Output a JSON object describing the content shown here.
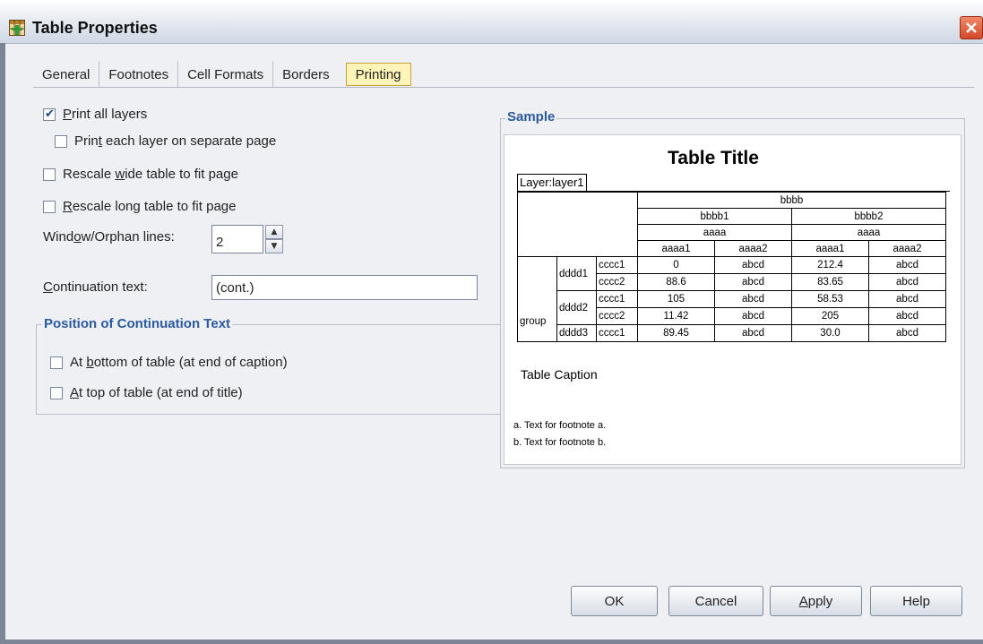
{
  "window": {
    "title": "Table Properties"
  },
  "tabs": [
    {
      "label": "General",
      "active": false
    },
    {
      "label": "Footnotes",
      "active": false
    },
    {
      "label": "Cell Formats",
      "active": false
    },
    {
      "label": "Borders",
      "active": false
    },
    {
      "label": "Printing",
      "active": true
    }
  ],
  "options": {
    "print_all_layers": {
      "pre": "",
      "key": "P",
      "post": "rint all layers",
      "checked": true
    },
    "print_each_layer": {
      "pre": "Prin",
      "key": "t",
      "post": " each layer on separate page",
      "checked": false
    },
    "rescale_wide": {
      "pre": "Rescale ",
      "key": "w",
      "post": "ide table to fit page",
      "checked": false
    },
    "rescale_long": {
      "pre": "",
      "key": "R",
      "post": "escale long table to fit page",
      "checked": false
    }
  },
  "widow_orphan": {
    "pre": "Wind",
    "key": "o",
    "post": "w/Orphan lines:",
    "value": "2"
  },
  "continuation": {
    "pre": "",
    "key": "C",
    "post": "ontinuation text:",
    "value": "(cont.)"
  },
  "position_group": {
    "title": "Position of Continuation Text",
    "bottom": {
      "pre": "At ",
      "key": "b",
      "post": "ottom of table (at end of caption)",
      "checked": false
    },
    "top": {
      "pre": "",
      "key": "A",
      "post": "t top of table (at end of title)",
      "checked": false
    }
  },
  "sample": {
    "group_title": "Sample",
    "table_title": "Table Title",
    "layer_label": "Layer:layer1",
    "col_top": "bbbb",
    "col_mid": [
      "bbbb1",
      "bbbb2"
    ],
    "col_sub": [
      "aaaa",
      "aaaa"
    ],
    "col_leaf": [
      "aaaa1",
      "aaaa2",
      "aaaa1",
      "aaaa2"
    ],
    "group_label": "group",
    "row_groups": [
      "dddd1",
      "dddd2",
      "dddd3"
    ],
    "rows": [
      {
        "c": "cccc1",
        "v": [
          "0",
          "abcd",
          "212.4",
          "abcd"
        ]
      },
      {
        "c": "cccc2",
        "v": [
          "88.6",
          "abcd",
          "83.65",
          "abcd"
        ]
      },
      {
        "c": "cccc1",
        "v": [
          "105",
          "abcd",
          "58.53",
          "abcd"
        ]
      },
      {
        "c": "cccc2",
        "v": [
          "11.42",
          "abcd",
          "205",
          "abcd"
        ]
      },
      {
        "c": "cccc1",
        "v": [
          "89.45",
          "abcd",
          "30.0",
          "abcd"
        ]
      }
    ],
    "caption": "Table Caption",
    "footnotes": [
      "a. Text for footnote a.",
      "b. Text for footnote b."
    ]
  },
  "buttons": {
    "ok": {
      "pre": "OK",
      "key": "",
      "post": ""
    },
    "cancel": {
      "pre": "Cancel",
      "key": "",
      "post": ""
    },
    "apply": {
      "pre": "",
      "key": "A",
      "post": "pply"
    },
    "help": {
      "pre": "Help",
      "key": "",
      "post": ""
    }
  },
  "colors": {
    "accent": "#2c5aa0",
    "active_tab": "#fff4b8",
    "close_button": "#d4482a"
  }
}
